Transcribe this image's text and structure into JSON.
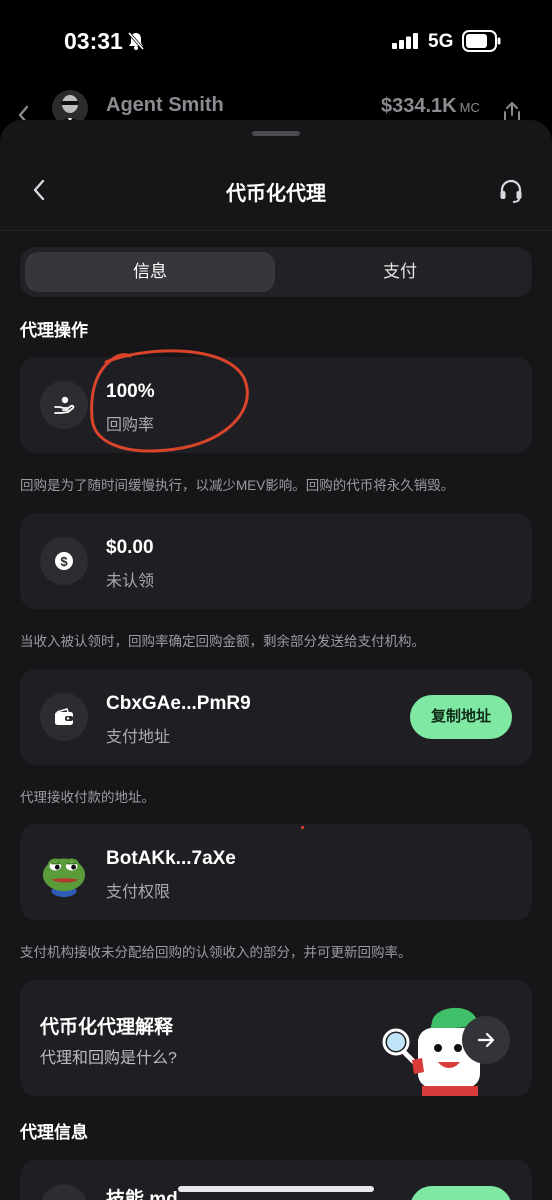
{
  "status_bar": {
    "time": "03:31",
    "network": "5G",
    "icons": [
      "bell-off-icon",
      "signal-icon",
      "battery-icon"
    ]
  },
  "background_header": {
    "name": "Agent Smith",
    "market_cap": "$334.1K",
    "market_cap_suffix": "MC"
  },
  "sheet": {
    "title": "代币化代理",
    "tabs": [
      {
        "label": "信息",
        "active": true
      },
      {
        "label": "支付",
        "active": false
      }
    ]
  },
  "agent_actions": {
    "section_title": "代理操作",
    "buyback": {
      "value": "100%",
      "label": "回购率",
      "icon": "hand-coin-icon",
      "description": "回购是为了随时间缓慢执行，以减少MEV影响。回购的代币将永久销毁。"
    },
    "unclaimed": {
      "value": "$0.00",
      "label": "未认领",
      "icon": "dollar-coin-icon",
      "description": "当收入被认领时，回购率确定回购金额，剩余部分发送给支付机构。"
    },
    "payment_address": {
      "value": "CbxGAe...PmR9",
      "label": "支付地址",
      "icon": "wallet-icon",
      "button": "复制地址",
      "description": "代理接收付款的地址。"
    },
    "payment_authority": {
      "value": "BotAKk...7aXe",
      "label": "支付权限",
      "icon": "pepe-avatar-icon",
      "description": "支付机构接收未分配给回购的认领收入的部分，并可更新回购率。"
    }
  },
  "explainer": {
    "title": "代币化代理解释",
    "subtitle": "代理和回购是什么?"
  },
  "agent_info": {
    "section_title": "代理信息",
    "partial_value": "技能.md"
  },
  "colors": {
    "accent_green": "#7fe8a3",
    "card_bg": "#1f1f23",
    "sheet_bg": "#161619",
    "annotation_red": "#d9442b"
  }
}
